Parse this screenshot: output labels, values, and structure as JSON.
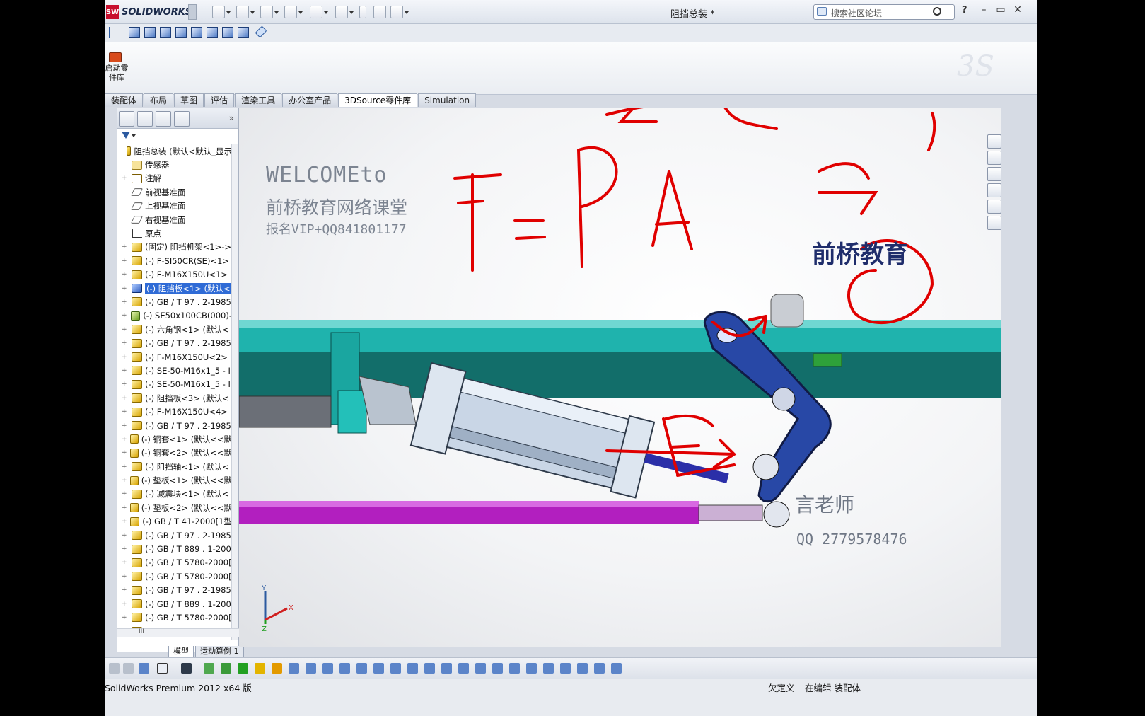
{
  "window": {
    "brand": "SOLIDWORKS",
    "title": "阻挡总装 *",
    "search_placeholder": "搜索社区论坛",
    "help": "?"
  },
  "command_manager": {
    "start_library_label": "启动零件库",
    "tabs": [
      "装配体",
      "布局",
      "草图",
      "评估",
      "渲染工具",
      "办公室产品",
      "3DSource零件库",
      "Simulation"
    ],
    "active_tab": "3DSource零件库"
  },
  "feature_tree": {
    "items": [
      {
        "label": "阻挡总装  (默认<默认_显示",
        "icon": "assembly-icon",
        "expand": ""
      },
      {
        "label": "传感器",
        "icon": "sensor-icon",
        "expand": ""
      },
      {
        "label": "注解",
        "icon": "annotation-icon",
        "expand": "+"
      },
      {
        "label": "前视基准面",
        "icon": "plane-icon",
        "expand": ""
      },
      {
        "label": "上视基准面",
        "icon": "plane-icon",
        "expand": ""
      },
      {
        "label": "右视基准面",
        "icon": "plane-icon",
        "expand": ""
      },
      {
        "label": "原点",
        "icon": "origin-icon",
        "expand": ""
      },
      {
        "label": "(固定) 阻挡机架<1>->",
        "icon": "part-icon",
        "expand": "+"
      },
      {
        "label": "(-) F-SI50CR(SE)<1>",
        "icon": "part-icon",
        "expand": "+"
      },
      {
        "label": "(-) F-M16X150U<1>",
        "icon": "part-icon",
        "expand": "+"
      },
      {
        "label": "(-) 阻挡板<1> (默认<",
        "icon": "part-blue-icon",
        "expand": "+",
        "selected": true
      },
      {
        "label": "(-) GB / T 97 . 2-1985",
        "icon": "part-icon",
        "expand": "+"
      },
      {
        "label": "(-) SE50x100CB(000)-",
        "icon": "subassembly-icon",
        "expand": "+"
      },
      {
        "label": "(-) 六角钢<1> (默认<",
        "icon": "part-icon",
        "expand": "+"
      },
      {
        "label": "(-) GB / T 97 . 2-1985",
        "icon": "part-icon",
        "expand": "+"
      },
      {
        "label": "(-) F-M16X150U<2>",
        "icon": "part-icon",
        "expand": "+"
      },
      {
        "label": "(-) SE-50-M16x1_5 - I",
        "icon": "part-icon",
        "expand": "+"
      },
      {
        "label": "(-) SE-50-M16x1_5 - I",
        "icon": "part-icon",
        "expand": "+"
      },
      {
        "label": "(-) 阻挡板<3> (默认<",
        "icon": "part-icon",
        "expand": "+"
      },
      {
        "label": "(-) F-M16X150U<4>",
        "icon": "part-icon",
        "expand": "+"
      },
      {
        "label": "(-) GB / T 97 . 2-1985",
        "icon": "part-icon",
        "expand": "+"
      },
      {
        "label": "(-) 铜套<1> (默认<<默",
        "icon": "part-icon",
        "expand": "+"
      },
      {
        "label": "(-) 铜套<2> (默认<<默",
        "icon": "part-icon",
        "expand": "+"
      },
      {
        "label": "(-) 阻挡轴<1> (默认<",
        "icon": "part-icon",
        "expand": "+"
      },
      {
        "label": "(-) 垫板<1> (默认<<默",
        "icon": "part-icon",
        "expand": "+"
      },
      {
        "label": "(-) 减震块<1> (默认<",
        "icon": "part-icon",
        "expand": "+"
      },
      {
        "label": "(-) 垫板<2> (默认<<默",
        "icon": "part-icon",
        "expand": "+"
      },
      {
        "label": "(-) GB / T 41-2000[1型",
        "icon": "part-icon",
        "expand": "+"
      },
      {
        "label": "(-) GB / T 97 . 2-1985",
        "icon": "part-icon",
        "expand": "+"
      },
      {
        "label": "(-) GB / T 889 . 1-200",
        "icon": "part-icon",
        "expand": "+"
      },
      {
        "label": "(-) GB / T 5780-2000[",
        "icon": "part-icon",
        "expand": "+"
      },
      {
        "label": "(-) GB / T 5780-2000[",
        "icon": "part-icon",
        "expand": "+"
      },
      {
        "label": "(-) GB / T 97 . 2-1985",
        "icon": "part-icon",
        "expand": "+"
      },
      {
        "label": "(-) GB / T 889 . 1-200",
        "icon": "part-icon",
        "expand": "+"
      },
      {
        "label": "(-) GB / T 5780-2000[",
        "icon": "part-icon",
        "expand": "+"
      },
      {
        "label": "(-) GB / T 97 . 2-1985",
        "icon": "part-icon",
        "expand": "+"
      }
    ],
    "hscroll_label": "III",
    "bottom_tabs": [
      "模型",
      "运动算例 1"
    ]
  },
  "viewport": {
    "watermark_welcome": "WELCOMEto",
    "watermark_school": "前桥教育网络课堂",
    "watermark_vip": "报名VIP+QQ841801177",
    "brand_logo_text": "前桥教育",
    "teacher": "言老师",
    "teacher_qq": "QQ 2779578476",
    "triad_y": "Y",
    "triad_x": "X",
    "triad_z": "Z",
    "annotation_formula": "F = P · A",
    "colors": {
      "frame": "#1a8f8a",
      "link": "#1f3f8a",
      "rod": "#b21fbf",
      "ink": "#e00000",
      "cylinder": "#c9d6e6"
    }
  },
  "statusbar": {
    "app": "SolidWorks Premium 2012 x64 版",
    "definition": "欠定义",
    "editing": "在编辑 装配体"
  }
}
